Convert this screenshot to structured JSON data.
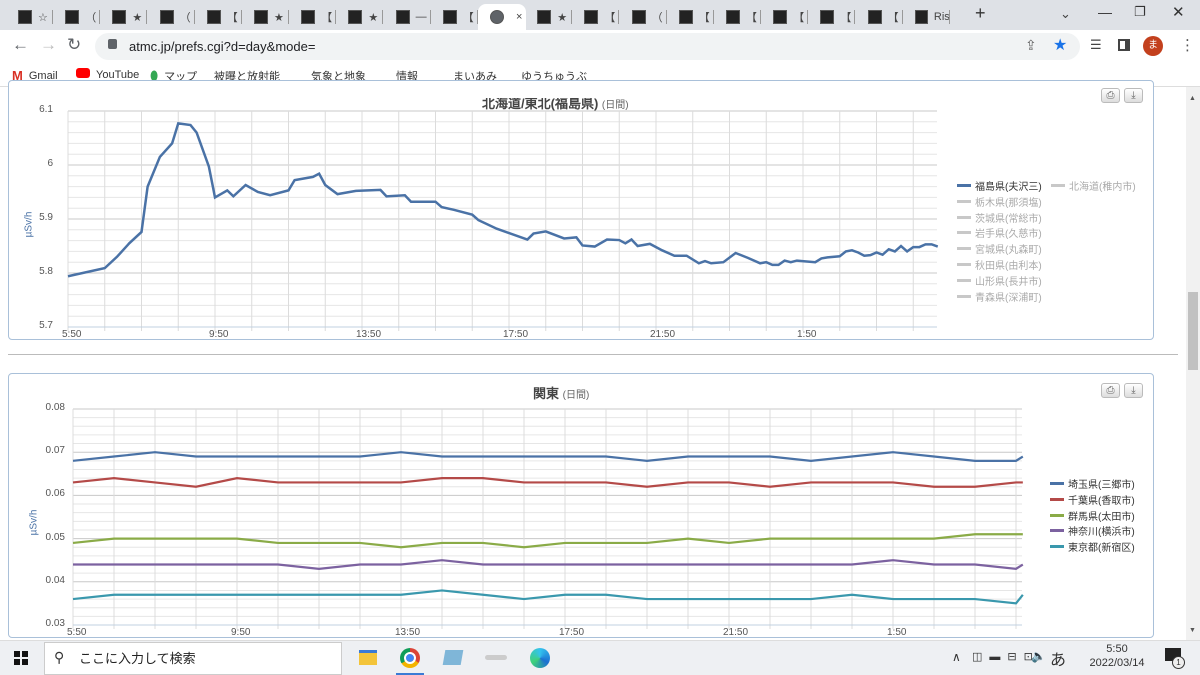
{
  "browser": {
    "tabs": [
      {
        "label": "☆"
      },
      {
        "label": "（"
      },
      {
        "label": "★"
      },
      {
        "label": "（"
      },
      {
        "label": "【"
      },
      {
        "label": "★"
      },
      {
        "label": "【"
      },
      {
        "label": "★"
      },
      {
        "label": "―"
      },
      {
        "label": "【"
      },
      {
        "label": "",
        "active": true
      },
      {
        "label": "★"
      },
      {
        "label": "【"
      },
      {
        "label": "（"
      },
      {
        "label": "【"
      },
      {
        "label": "【"
      },
      {
        "label": "【"
      },
      {
        "label": "【"
      },
      {
        "label": "【"
      },
      {
        "label": "Ris"
      }
    ],
    "new_tab": "+",
    "close_tab": "×",
    "url": "atmc.jp/prefs.cgi?d=day&mode=",
    "profile_initial": "ま",
    "bookmarks": [
      "Gmail",
      "YouTube",
      "マップ",
      "被曝と放射能",
      "気象と地象",
      "情報",
      "まいあみ",
      "ゆうちゅうぶ"
    ]
  },
  "print_label": "⎙",
  "download_label": "⤓",
  "chart_data": [
    {
      "type": "line",
      "title": "北海道/東北(福島県)",
      "title_suffix": "(日間)",
      "ylabel": "µSv/h",
      "ylim": [
        5.7,
        6.1
      ],
      "yticks": [
        "5.7",
        "5.8",
        "5.9",
        "6",
        "6.1"
      ],
      "xticks": [
        "5:50",
        "9:50",
        "13:50",
        "17:50",
        "21:50",
        "1:50"
      ],
      "grid": true,
      "legend": "right",
      "legend_entries": [
        {
          "name": "福島県(夫沢三)",
          "active": true
        },
        {
          "name": "北海道(稚内市)"
        },
        {
          "name": "栃木県(那須塩)"
        },
        {
          "name": "茨城県(常総市)"
        },
        {
          "name": "岩手県(久慈市)"
        },
        {
          "name": "宮城県(丸森町)"
        },
        {
          "name": "秋田県(由利本)"
        },
        {
          "name": "山形県(長井市)"
        },
        {
          "name": "青森県(深浦町)"
        }
      ],
      "colors": {
        "active": "#4a72a6",
        "inactive": "#c8c8c8"
      },
      "series": [
        {
          "name": "福島県(夫沢三)",
          "x": [
            "5:50",
            "6:50",
            "7:10",
            "7:30",
            "7:50",
            "8:00",
            "8:20",
            "8:40",
            "8:50",
            "9:10",
            "9:20",
            "9:40",
            "9:50",
            "10:10",
            "10:20",
            "10:40",
            "11:00",
            "11:20",
            "11:50",
            "12:00",
            "12:30",
            "12:40",
            "12:50",
            "13:10",
            "13:40",
            "14:20",
            "14:30",
            "15:00",
            "15:10",
            "15:50",
            "16:00",
            "16:20",
            "16:50",
            "17:00",
            "17:30",
            "18:20",
            "18:30",
            "18:50",
            "19:20",
            "19:40",
            "19:50",
            "20:10",
            "20:30",
            "20:50",
            "21:00",
            "21:10",
            "21:20",
            "21:40",
            "22:00",
            "22:20",
            "22:40",
            "23:00",
            "23:10",
            "23:20",
            "23:40",
            "0:00",
            "0:20",
            "0:40",
            "0:50",
            "1:00",
            "1:10",
            "1:20",
            "1:30",
            "1:40",
            "2:10",
            "2:20",
            "2:30",
            "2:50",
            "3:00",
            "3:10",
            "3:20",
            "3:30",
            "3:40",
            "3:50",
            "4:00",
            "4:10",
            "4:20",
            "4:30",
            "4:40",
            "4:50",
            "5:00",
            "5:10",
            "5:20",
            "5:30"
          ],
          "y": [
            5.794,
            5.809,
            5.83,
            5.855,
            5.876,
            5.96,
            6.015,
            6.04,
            6.077,
            6.074,
            6.06,
            5.997,
            5.94,
            5.953,
            5.942,
            5.963,
            5.95,
            5.944,
            5.953,
            5.972,
            5.978,
            5.984,
            5.963,
            5.946,
            5.952,
            5.954,
            5.942,
            5.944,
            5.932,
            5.932,
            5.922,
            5.917,
            5.908,
            5.898,
            5.882,
            5.862,
            5.873,
            5.877,
            5.864,
            5.866,
            5.851,
            5.849,
            5.862,
            5.861,
            5.855,
            5.862,
            5.85,
            5.854,
            5.842,
            5.832,
            5.832,
            5.818,
            5.822,
            5.818,
            5.82,
            5.837,
            5.828,
            5.818,
            5.82,
            5.815,
            5.815,
            5.823,
            5.82,
            5.823,
            5.82,
            5.827,
            5.829,
            5.831,
            5.84,
            5.842,
            5.838,
            5.832,
            5.833,
            5.838,
            5.834,
            5.844,
            5.84,
            5.85,
            5.84,
            5.848,
            5.848,
            5.853,
            5.853,
            5.849
          ]
        }
      ]
    },
    {
      "type": "line",
      "title": "関東",
      "title_suffix": "(日間)",
      "ylabel": "µSv/h",
      "ylim": [
        0.03,
        0.08
      ],
      "yticks": [
        "0.03",
        "0.04",
        "0.05",
        "0.06",
        "0.07",
        "0.08"
      ],
      "xticks": [
        "5:50",
        "9:50",
        "13:50",
        "17:50",
        "21:50",
        "1:50"
      ],
      "grid": true,
      "legend": "right",
      "x": [
        "5:50",
        "6:50",
        "7:50",
        "8:50",
        "9:50",
        "10:50",
        "11:50",
        "12:50",
        "13:50",
        "14:50",
        "15:50",
        "16:50",
        "17:50",
        "18:50",
        "19:50",
        "20:50",
        "21:50",
        "22:50",
        "23:50",
        "0:50",
        "1:50",
        "2:50",
        "3:50",
        "4:50",
        "5:00"
      ],
      "series": [
        {
          "name": "埼玉県(三郷市)",
          "color": "#4a72a6",
          "y": [
            0.068,
            0.069,
            0.07,
            0.069,
            0.069,
            0.069,
            0.069,
            0.069,
            0.07,
            0.069,
            0.069,
            0.069,
            0.069,
            0.069,
            0.068,
            0.069,
            0.069,
            0.069,
            0.068,
            0.069,
            0.07,
            0.069,
            0.068,
            0.068,
            0.069
          ]
        },
        {
          "name": "千葉県(香取市)",
          "color": "#b44a48",
          "y": [
            0.063,
            0.064,
            0.063,
            0.062,
            0.064,
            0.063,
            0.063,
            0.063,
            0.063,
            0.064,
            0.064,
            0.063,
            0.063,
            0.063,
            0.062,
            0.063,
            0.063,
            0.062,
            0.063,
            0.063,
            0.063,
            0.062,
            0.062,
            0.063,
            0.063
          ]
        },
        {
          "name": "群馬県(太田市)",
          "color": "#8aab47",
          "y": [
            0.049,
            0.05,
            0.05,
            0.05,
            0.05,
            0.049,
            0.049,
            0.049,
            0.048,
            0.049,
            0.049,
            0.048,
            0.049,
            0.049,
            0.049,
            0.05,
            0.049,
            0.05,
            0.05,
            0.05,
            0.05,
            0.05,
            0.051,
            0.051,
            0.051
          ]
        },
        {
          "name": "神奈川(横浜市)",
          "color": "#7c62a0",
          "y": [
            0.044,
            0.044,
            0.044,
            0.044,
            0.044,
            0.044,
            0.043,
            0.044,
            0.044,
            0.045,
            0.044,
            0.044,
            0.044,
            0.044,
            0.044,
            0.044,
            0.044,
            0.044,
            0.044,
            0.044,
            0.045,
            0.044,
            0.044,
            0.043,
            0.044
          ]
        },
        {
          "name": "東京都(新宿区)",
          "color": "#3a98ad",
          "y": [
            0.036,
            0.037,
            0.037,
            0.037,
            0.037,
            0.037,
            0.037,
            0.037,
            0.037,
            0.038,
            0.037,
            0.036,
            0.037,
            0.037,
            0.036,
            0.036,
            0.036,
            0.036,
            0.036,
            0.037,
            0.036,
            0.036,
            0.036,
            0.035,
            0.037
          ]
        }
      ]
    }
  ],
  "taskbar": {
    "search_placeholder": "ここに入力して検索",
    "time": "5:50",
    "date": "2022/03/14",
    "ime": "あ",
    "notifications": "1"
  }
}
